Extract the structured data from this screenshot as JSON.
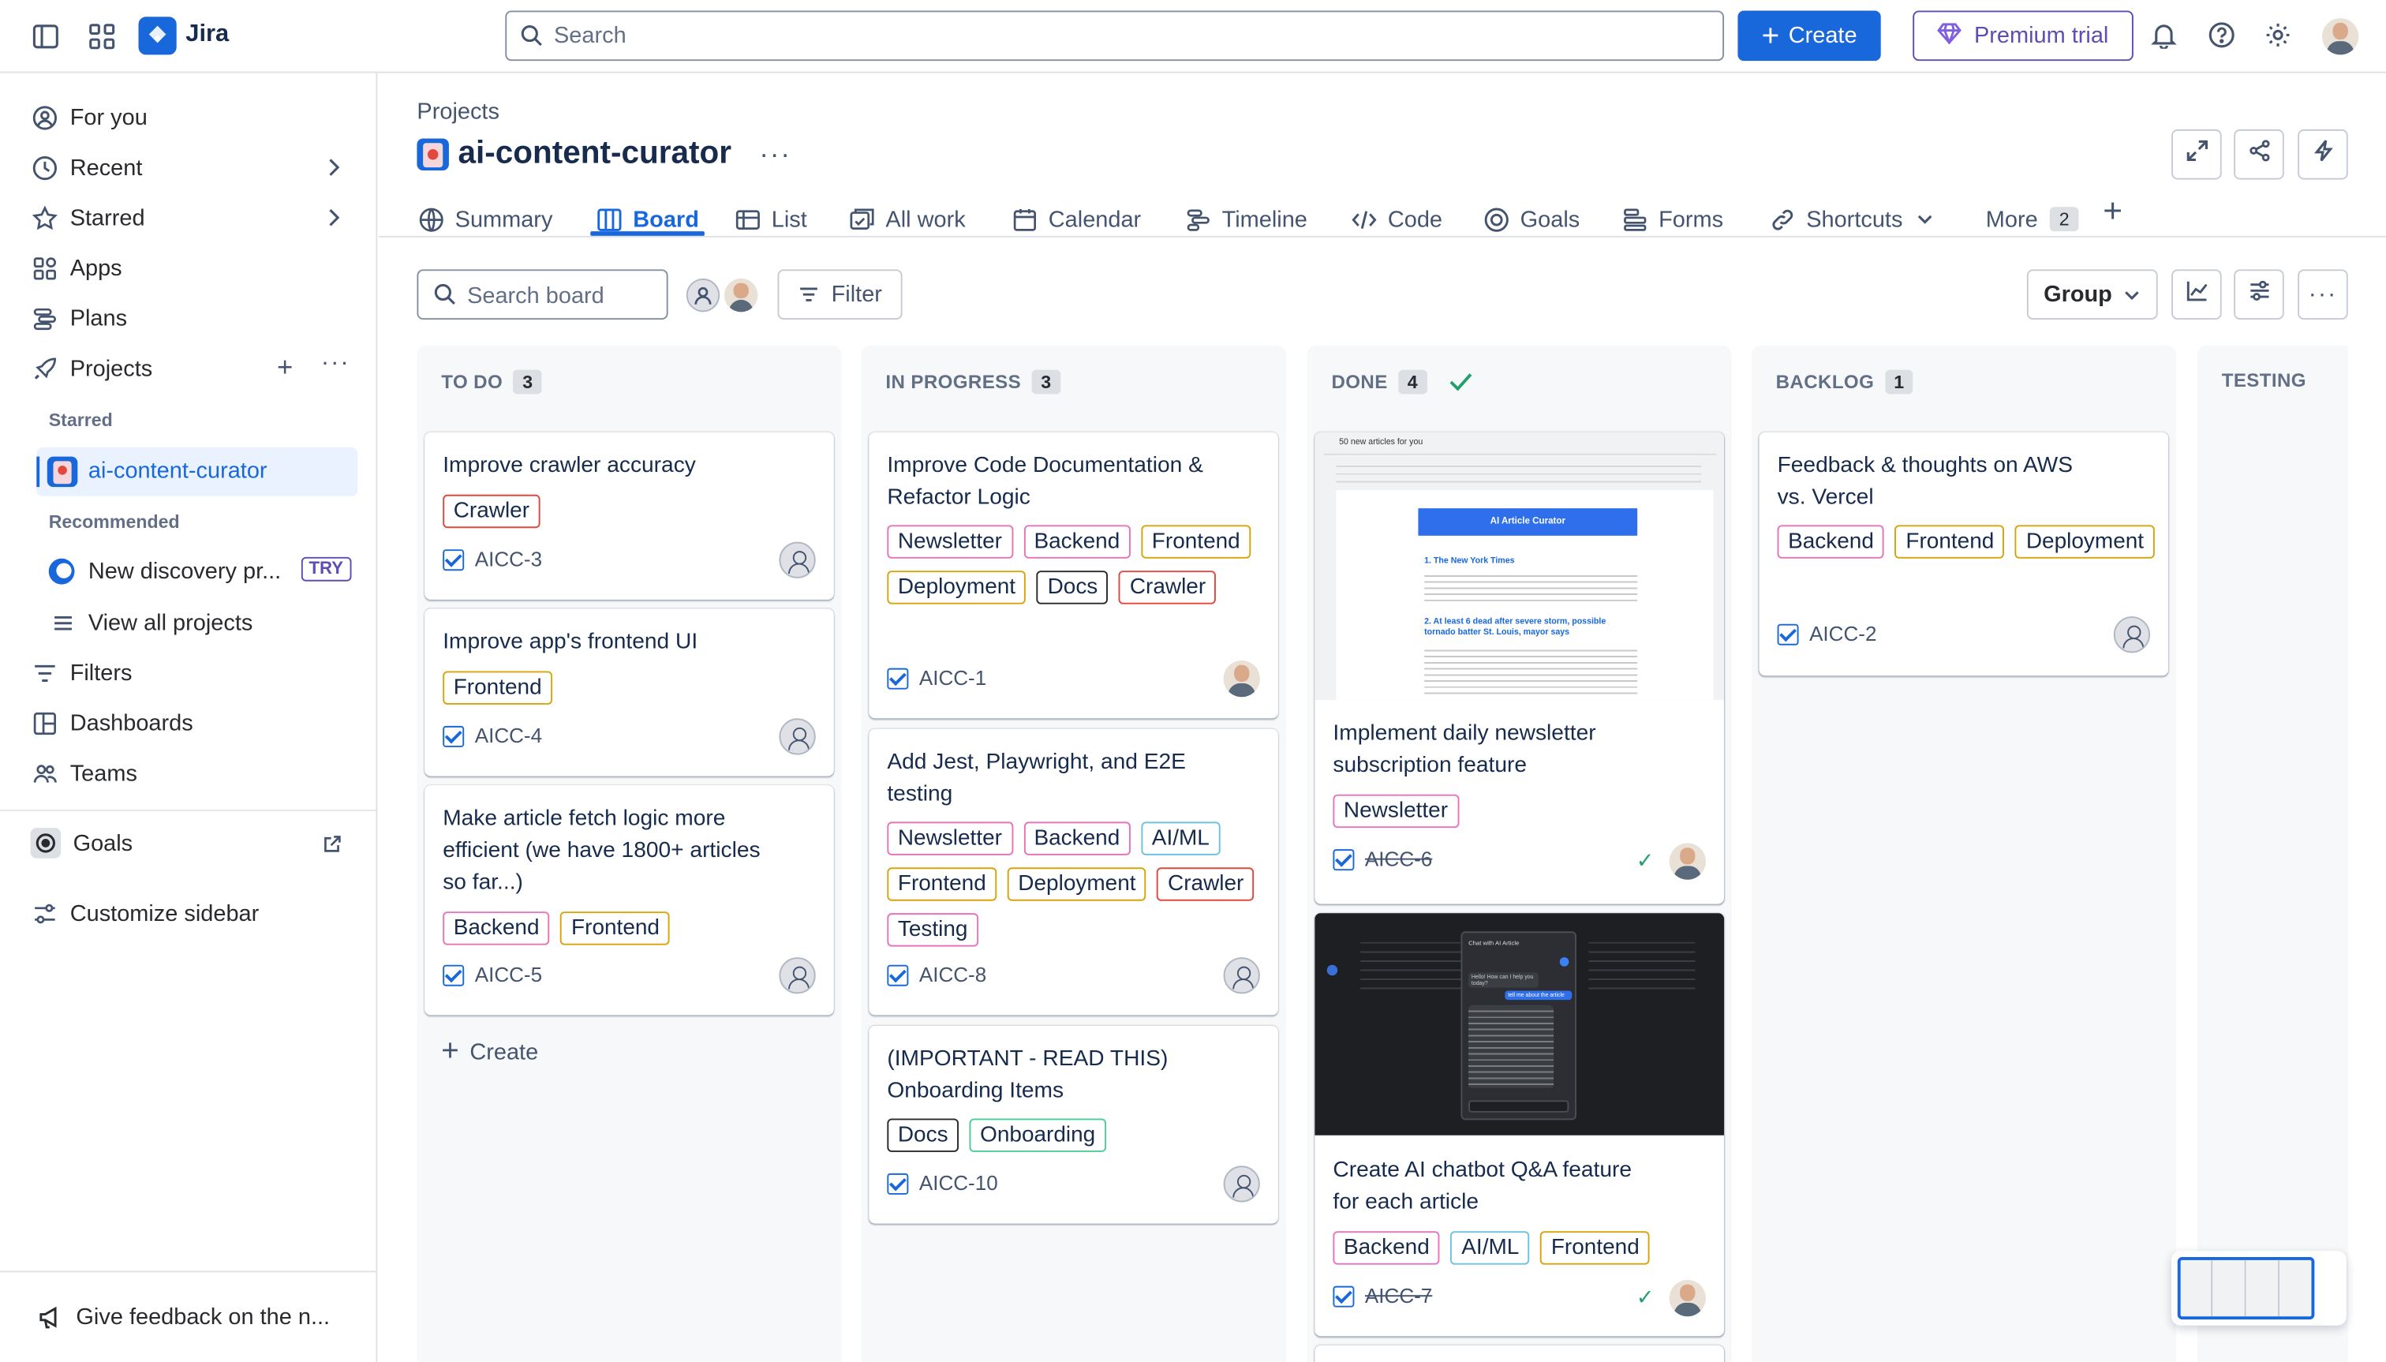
{
  "topbar": {
    "app_name": "Jira",
    "search_placeholder": "Search",
    "create_label": "Create",
    "premium_label": "Premium trial"
  },
  "sidebar": {
    "for_you": "For you",
    "recent": "Recent",
    "starred": "Starred",
    "apps": "Apps",
    "plans": "Plans",
    "projects": "Projects",
    "starred_heading": "Starred",
    "starred_project": "ai-content-curator",
    "recommended_heading": "Recommended",
    "recommended_item": "New discovery pr...",
    "try_badge": "TRY",
    "view_all": "View all projects",
    "filters": "Filters",
    "dashboards": "Dashboards",
    "teams": "Teams",
    "goals": "Goals",
    "customize": "Customize sidebar",
    "feedback": "Give feedback on the n..."
  },
  "project": {
    "breadcrumb": "Projects",
    "name": "ai-content-curator"
  },
  "tabs": {
    "summary": "Summary",
    "board": "Board",
    "list": "List",
    "all_work": "All work",
    "calendar": "Calendar",
    "timeline": "Timeline",
    "code": "Code",
    "goals": "Goals",
    "forms": "Forms",
    "shortcuts": "Shortcuts",
    "more": "More",
    "more_count": "2"
  },
  "toolbar": {
    "search_placeholder": "Search board",
    "filter_label": "Filter",
    "group_label": "Group"
  },
  "columns": {
    "todo": {
      "title": "TO DO",
      "count": "3",
      "create": "Create"
    },
    "inprogress": {
      "title": "IN PROGRESS",
      "count": "3"
    },
    "done": {
      "title": "DONE",
      "count": "4"
    },
    "backlog": {
      "title": "BACKLOG",
      "count": "1"
    },
    "testing": {
      "title": "TESTING"
    }
  },
  "cards": {
    "aicc3": {
      "title": "Improve crawler accuracy",
      "labels": [
        "Crawler"
      ],
      "key": "AICC-3"
    },
    "aicc4": {
      "title": "Improve app's frontend UI",
      "labels": [
        "Frontend"
      ],
      "key": "AICC-4"
    },
    "aicc5": {
      "title": "Make article fetch logic more efficient (we have 1800+ articles so far...)",
      "labels": [
        "Backend",
        "Frontend"
      ],
      "key": "AICC-5"
    },
    "aicc1": {
      "title": "Improve Code Documentation & Refactor Logic",
      "labels": [
        "Newsletter",
        "Backend",
        "Frontend",
        "Deployment",
        "Docs",
        "Crawler"
      ],
      "key": "AICC-1"
    },
    "aicc8": {
      "title": "Add Jest, Playwright, and E2E testing",
      "labels": [
        "Newsletter",
        "Backend",
        "AI/ML",
        "Frontend",
        "Deployment",
        "Crawler",
        "Testing"
      ],
      "key": "AICC-8"
    },
    "aicc10": {
      "title": "(IMPORTANT - READ THIS) Onboarding Items",
      "labels": [
        "Docs",
        "Onboarding"
      ],
      "key": "AICC-10"
    },
    "aicc6": {
      "title": "Implement daily newsletter subscription feature",
      "labels": [
        "Newsletter"
      ],
      "key": "AICC-6"
    },
    "aicc7": {
      "title": "Create AI chatbot Q&A feature for each article",
      "labels": [
        "Backend",
        "AI/ML",
        "Frontend"
      ],
      "key": "AICC-7"
    },
    "aicc2": {
      "title": "Feedback & thoughts on AWS vs. Vercel",
      "labels": [
        "Backend",
        "Frontend",
        "Deployment"
      ],
      "key": "AICC-2"
    }
  },
  "newsletter_preview": {
    "subject": "50 new articles for you",
    "banner": "AI Article Curator",
    "item1": "1. The New York Times",
    "item2": "2. At least 6 dead after severe storm, possible tornado batter St. Louis, mayor says"
  },
  "chat_preview": {
    "header": "Chat with AI Article",
    "user_msg": "Hello! How can I help you today?",
    "q": "tell me about the article"
  },
  "colors": {
    "accent": "#1868db",
    "premium": "#5e4db2"
  }
}
